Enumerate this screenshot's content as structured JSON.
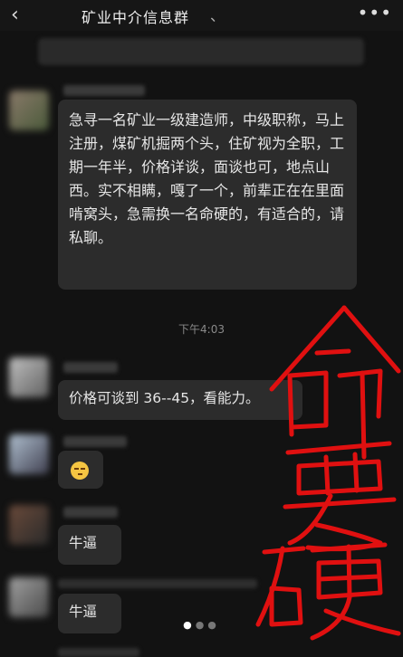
{
  "header": {
    "back_icon": "back-chevron",
    "title": "矿业中介信息群",
    "title_suffix": "、",
    "more_icon": "more-dots"
  },
  "messages": [
    {
      "id": "m1",
      "text": "急寻一名矿业一级建造师，中级职称，马上注册，煤矿机掘两个头，住矿视为全职，工期一年半，价格详谈，面谈也可，地点山西。实不相瞒，嘎了一个，前辈正在在里面啃窝头，急需换一名命硬的，有适合的，请私聊。"
    },
    {
      "id": "m2",
      "text": "价格可谈到 36--45，看能力。"
    },
    {
      "id": "m3",
      "text": "emoji"
    },
    {
      "id": "m4",
      "text": "牛逼"
    },
    {
      "id": "m5",
      "text": "牛逼"
    }
  ],
  "timestamp": "下午4:03",
  "annotation": {
    "text": "命要硬",
    "color": "#e01010"
  },
  "pager": {
    "count": 3,
    "active": 0
  }
}
